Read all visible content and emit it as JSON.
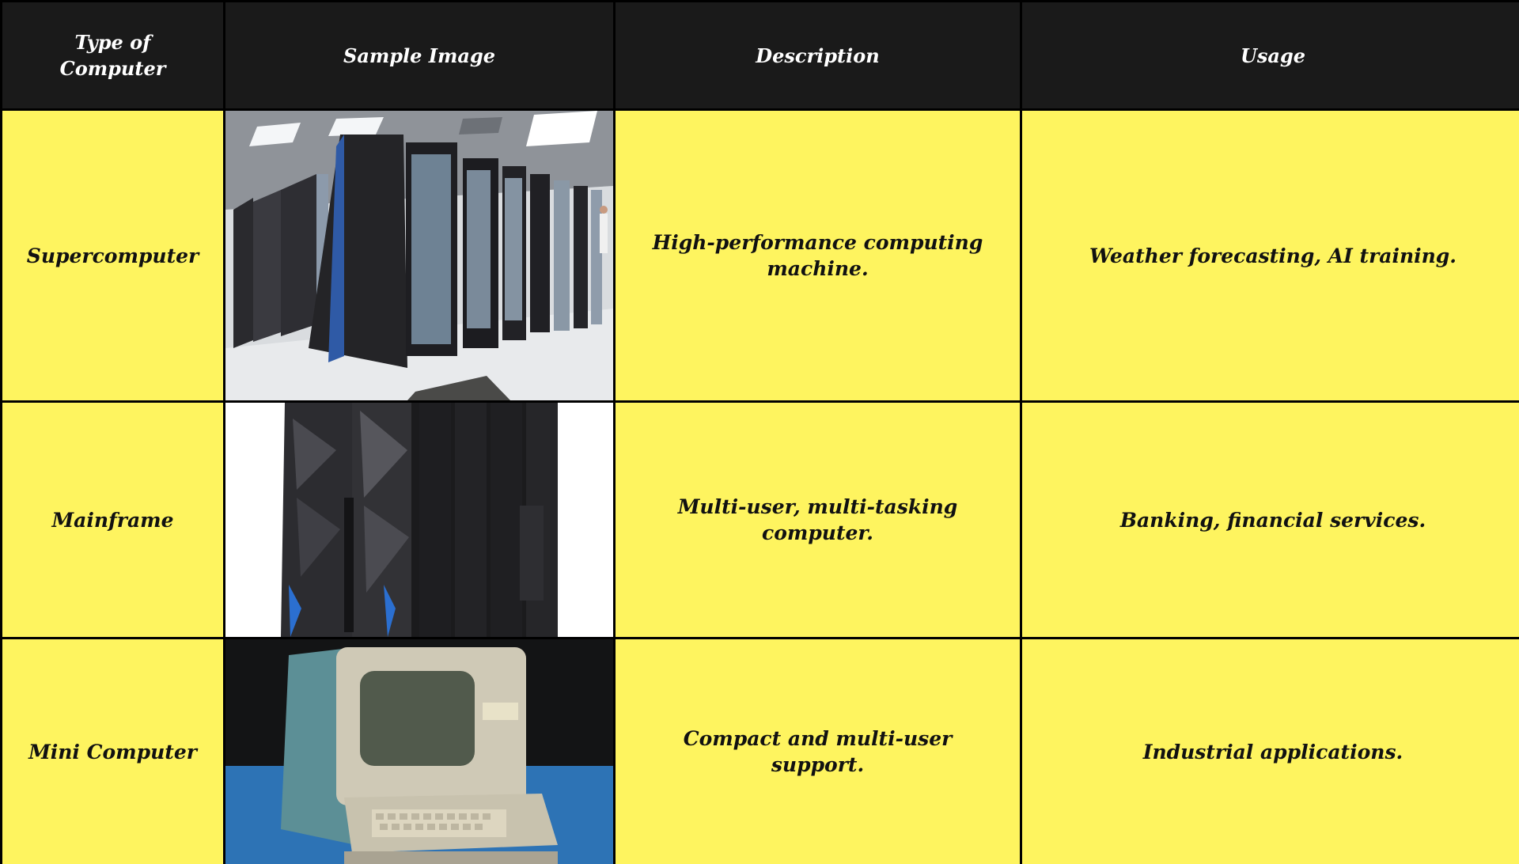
{
  "table": {
    "headers": [
      "Type of Computer",
      "Sample Image",
      "Description",
      "Usage"
    ],
    "rows": [
      {
        "type": "Supercomputer",
        "image": "supercomputer-image",
        "description": "High-performance computing machine.",
        "usage": "Weather forecasting, AI training."
      },
      {
        "type": "Mainframe",
        "image": "mainframe-image",
        "description": "Multi-user, multi-tasking computer.",
        "usage": "Banking, financial services."
      },
      {
        "type": "Mini Computer",
        "image": "mini-computer-image",
        "description": "Compact and multi-user support.",
        "usage": "Industrial applications."
      }
    ]
  },
  "colors": {
    "header_bg": "#1a1a1a",
    "cell_bg": "#fef45f",
    "border": "#000000"
  }
}
